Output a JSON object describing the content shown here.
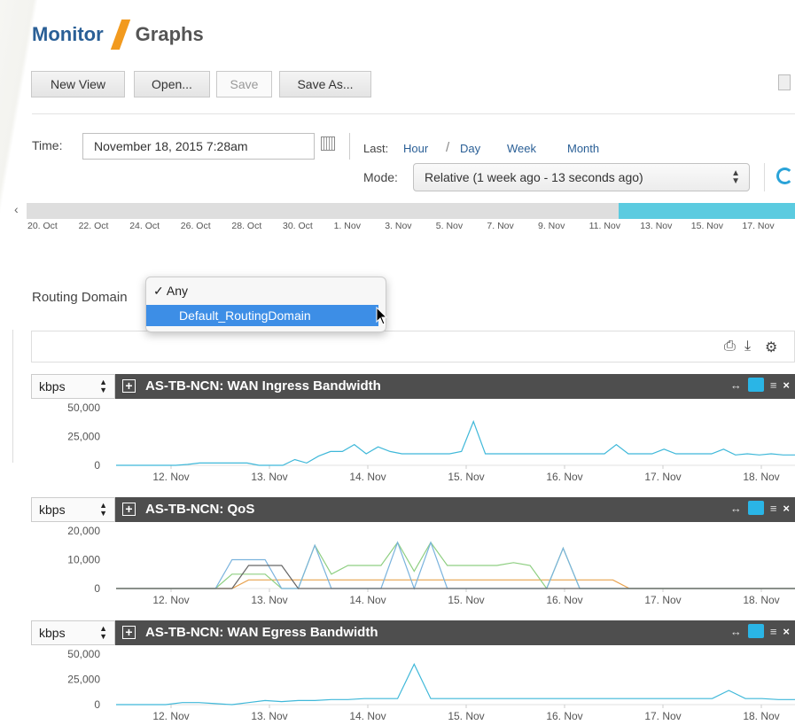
{
  "breadcrumb": {
    "section": "Monitor",
    "page": "Graphs"
  },
  "toolbar": {
    "new_view": "New View",
    "open": "Open...",
    "save": "Save",
    "save_as": "Save As..."
  },
  "time": {
    "label": "Time:",
    "value": "November 18, 2015 7:28am",
    "last_label": "Last:",
    "ranges": [
      "Hour",
      "Day",
      "Week",
      "Month"
    ],
    "mode_label": "Mode:",
    "mode_value": "Relative (1 week ago - 13 seconds ago)"
  },
  "timeline": {
    "labels": [
      "20. Oct",
      "22. Oct",
      "24. Oct",
      "26. Oct",
      "28. Oct",
      "30. Oct",
      "1. Nov",
      "3. Nov",
      "5. Nov",
      "7. Nov",
      "9. Nov",
      "11. Nov",
      "13. Nov",
      "15. Nov",
      "17. Nov"
    ],
    "selection_fraction": 0.23
  },
  "routing_domain": {
    "label": "Routing Domain",
    "options": [
      "Any",
      "Default_RoutingDomain"
    ],
    "checked": "Any",
    "highlighted": "Default_RoutingDomain"
  },
  "graphs": [
    {
      "unit": "kbps",
      "title": "AS-TB-NCN: WAN Ingress Bandwidth",
      "chart_data": {
        "type": "line",
        "x": [
          "11.4",
          "11.5",
          "11.6",
          "11.7",
          "11.8",
          "11.9",
          "12.0",
          "12.1",
          "12.2",
          "12.3",
          "12.4",
          "12.5",
          "12.6",
          "12.7",
          "12.8",
          "12.9",
          "13.0",
          "13.1",
          "13.2",
          "13.3",
          "13.4",
          "13.5",
          "13.6",
          "13.7",
          "13.8",
          "13.9",
          "14.0",
          "14.1",
          "14.2",
          "14.3",
          "14.4",
          "14.5",
          "14.6",
          "14.7",
          "14.8",
          "14.9",
          "15.0",
          "15.5",
          "16.0",
          "16.5",
          "16.6",
          "16.7",
          "16.8",
          "16.9",
          "17.0",
          "17.1",
          "17.2",
          "17.3",
          "17.4",
          "17.5",
          "17.6",
          "17.7",
          "17.8",
          "17.9",
          "18.0",
          "18.1",
          "18.2",
          "18.3"
        ],
        "categories": [
          "12. Nov",
          "13. Nov",
          "14. Nov",
          "15. Nov",
          "16. Nov",
          "17. Nov",
          "18. Nov"
        ],
        "series": [
          {
            "values": [
              0,
              0,
              0,
              0,
              0,
              0,
              800,
              2000,
              2000,
              2000,
              2000,
              2000,
              0,
              0,
              0,
              5000,
              2000,
              8000,
              12000,
              12000,
              18000,
              10000,
              16000,
              12000,
              10000,
              10000,
              10000,
              10000,
              10000,
              12000,
              38000,
              10000,
              10000,
              10000,
              10000,
              10000,
              10000,
              10000,
              10000,
              10000,
              10000,
              10000,
              18000,
              10000,
              10000,
              10000,
              14000,
              10000,
              10000,
              10000,
              10000,
              14000,
              9000,
              10000,
              9000,
              10000,
              9000,
              9000
            ],
            "color": "#3fb8d9"
          }
        ],
        "ylim": [
          0,
          50000
        ],
        "yticks": [
          "50,000",
          "25,000",
          "0"
        ]
      }
    },
    {
      "unit": "kbps",
      "title": "AS-TB-NCN: QoS",
      "chart_data": {
        "type": "line",
        "categories": [
          "12. Nov",
          "13. Nov",
          "14. Nov",
          "15. Nov",
          "16. Nov",
          "17. Nov",
          "18. Nov"
        ],
        "series": [
          {
            "values": [
              0,
              0,
              0,
              0,
              0,
              0,
              0,
              0,
              3000,
              3000,
              3000,
              3000,
              3000,
              3000,
              3000,
              3000,
              3000,
              3000,
              3000,
              3000,
              3000,
              3000,
              3000,
              3000,
              3000,
              3000,
              3000,
              3000,
              3000,
              3000,
              3000,
              0,
              0,
              0,
              0,
              0,
              0,
              0,
              0,
              0,
              0,
              0
            ],
            "color": "#e8a24e"
          },
          {
            "values": [
              0,
              0,
              0,
              0,
              0,
              0,
              0,
              5000,
              5000,
              5000,
              0,
              0,
              15000,
              5000,
              8000,
              8000,
              8000,
              16000,
              6000,
              16000,
              8000,
              8000,
              8000,
              8000,
              9000,
              8000,
              0,
              14000,
              0,
              0,
              0,
              0,
              0,
              0,
              0,
              0,
              0,
              0,
              0,
              0,
              0,
              0
            ],
            "color": "#8fcf82"
          },
          {
            "values": [
              0,
              0,
              0,
              0,
              0,
              0,
              0,
              10000,
              10000,
              10000,
              0,
              0,
              15000,
              0,
              0,
              0,
              0,
              16000,
              0,
              16000,
              0,
              0,
              0,
              0,
              0,
              0,
              0,
              14000,
              0,
              0,
              0,
              0,
              0,
              0,
              0,
              0,
              0,
              0,
              0,
              0,
              0,
              0
            ],
            "color": "#7ab3dd"
          },
          {
            "values": [
              0,
              0,
              0,
              0,
              0,
              0,
              0,
              0,
              8000,
              8000,
              8000,
              0,
              0,
              0,
              0,
              0,
              0,
              0,
              0,
              0,
              0,
              0,
              0,
              0,
              0,
              0,
              0,
              0,
              0,
              0,
              0,
              0,
              0,
              0,
              0,
              0,
              0,
              0,
              0,
              0,
              0,
              0
            ],
            "color": "#666666"
          }
        ],
        "ylim": [
          0,
          20000
        ],
        "yticks": [
          "20,000",
          "10,000",
          "0"
        ]
      }
    },
    {
      "unit": "kbps",
      "title": "AS-TB-NCN: WAN Egress Bandwidth",
      "chart_data": {
        "type": "line",
        "categories": [
          "12. Nov",
          "13. Nov",
          "14. Nov",
          "15. Nov",
          "16. Nov",
          "17. Nov",
          "18. Nov"
        ],
        "series": [
          {
            "values": [
              0,
              0,
              0,
              0,
              2000,
              2000,
              1000,
              0,
              2000,
              4000,
              3000,
              4000,
              4000,
              5000,
              5000,
              6000,
              6000,
              6000,
              40000,
              6000,
              6000,
              6000,
              6000,
              6000,
              6000,
              6000,
              6000,
              6000,
              6000,
              6000,
              6000,
              6000,
              6000,
              6000,
              6000,
              6000,
              6000,
              14000,
              6000,
              6000,
              5000,
              5000
            ],
            "color": "#3fb8d9"
          }
        ],
        "ylim": [
          0,
          50000
        ],
        "yticks": [
          "50,000",
          "25,000",
          "0"
        ]
      }
    }
  ]
}
